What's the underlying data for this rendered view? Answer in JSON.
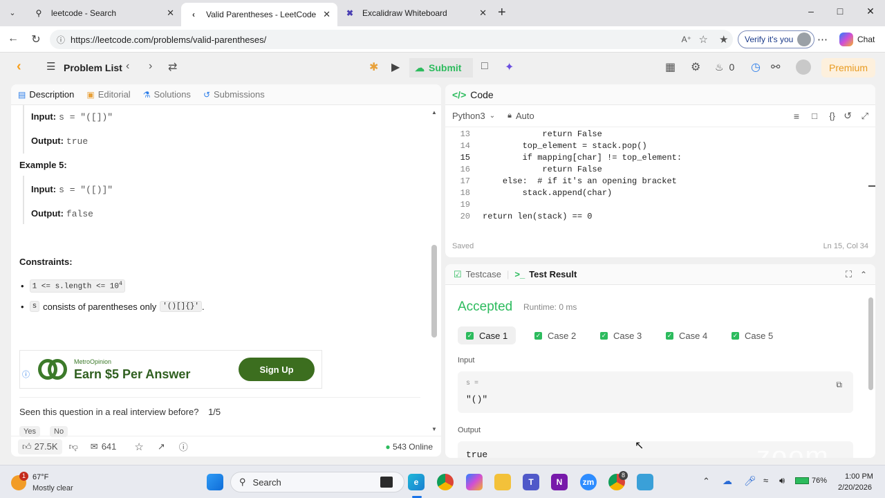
{
  "browser": {
    "tabs": [
      {
        "title": "leetcode - Search",
        "icon": "search-icon"
      },
      {
        "title": "Valid Parentheses - LeetCode",
        "icon": "leetcode-logo-icon"
      },
      {
        "title": "Excalidraw Whiteboard",
        "icon": "excalidraw-icon"
      }
    ],
    "url": "https://leetcode.com/problems/valid-parentheses/",
    "verify_label": "Verify it's you",
    "chat_label": "Chat"
  },
  "leetcode_nav": {
    "problem_list_label": "Problem List",
    "submit_label": "Submit",
    "streak_count": "0",
    "premium_label": "Premium"
  },
  "left_panel": {
    "tabs": [
      {
        "label": "Description",
        "icon": "description-icon"
      },
      {
        "label": "Editorial",
        "icon": "book-icon"
      },
      {
        "label": "Solutions",
        "icon": "flask-icon"
      },
      {
        "label": "Submissions",
        "icon": "history-icon"
      }
    ],
    "example4": {
      "input_label": "Input:",
      "input_value": "s = \"([])\"",
      "output_label": "Output:",
      "output_value": "true"
    },
    "example5": {
      "title": "Example 5:",
      "input_label": "Input:",
      "input_value": "s = \"([)]\"",
      "output_label": "Output:",
      "output_value": "false"
    },
    "constraints_title": "Constraints:",
    "constraint1_code": "1 <= s.length <= 10",
    "constraint1_sup": "4",
    "constraint2_code": "s",
    "constraint2_text": "consists of parentheses only",
    "constraint2_chars": "'()[]{}'",
    "constraint2_end": ".",
    "ad": {
      "brand": "MetroOpinion",
      "headline": "Earn $5 Per Answer",
      "button": "Sign Up"
    },
    "interview_question": "Seen this question in a real interview before?",
    "interview_progress": "1/5",
    "yes_label": "Yes",
    "no_label": "No",
    "likes": "27.5K",
    "comments": "641",
    "online": "543 Online"
  },
  "code_panel": {
    "title": "Code",
    "language": "Python3",
    "mode": "Auto",
    "status": "Saved",
    "cursor_pos": "Ln 15, Col 34",
    "lines": [
      {
        "n": "13",
        "indent": "            ",
        "code": "return False"
      },
      {
        "n": "14",
        "indent": "        ",
        "code": "top_element = stack.pop()"
      },
      {
        "n": "15",
        "indent": "        ",
        "code": "if mapping[char] != top_element:"
      },
      {
        "n": "16",
        "indent": "            ",
        "code": "return False"
      },
      {
        "n": "17",
        "indent": "    ",
        "code": "else:  # if it's an opening bracket"
      },
      {
        "n": "18",
        "indent": "        ",
        "code": "stack.append(char)"
      },
      {
        "n": "19",
        "indent": "",
        "code": ""
      },
      {
        "n": "20",
        "indent": "",
        "code": "return len(stack) == 0"
      }
    ]
  },
  "test_panel": {
    "testcase_tab": "Testcase",
    "result_tab": "Test Result",
    "verdict": "Accepted",
    "runtime": "Runtime: 0 ms",
    "cases": [
      "Case 1",
      "Case 2",
      "Case 3",
      "Case 4",
      "Case 5"
    ],
    "input_label": "Input",
    "var_label": "s =",
    "input_value": "\"()\"",
    "output_label": "Output",
    "output_value": "true"
  },
  "watermark": "zoom",
  "taskbar": {
    "weather_temp": "67°F",
    "weather_desc": "Mostly clear",
    "weather_badge": "1",
    "search_placeholder": "Search",
    "chrome_badge": "8",
    "battery": "76%",
    "time": "1:00 PM",
    "date": "2/20/2026"
  },
  "colors": {
    "accepted": "#2cbb5d",
    "premium": "#e89a1f",
    "link_blue": "#2b7de9"
  }
}
